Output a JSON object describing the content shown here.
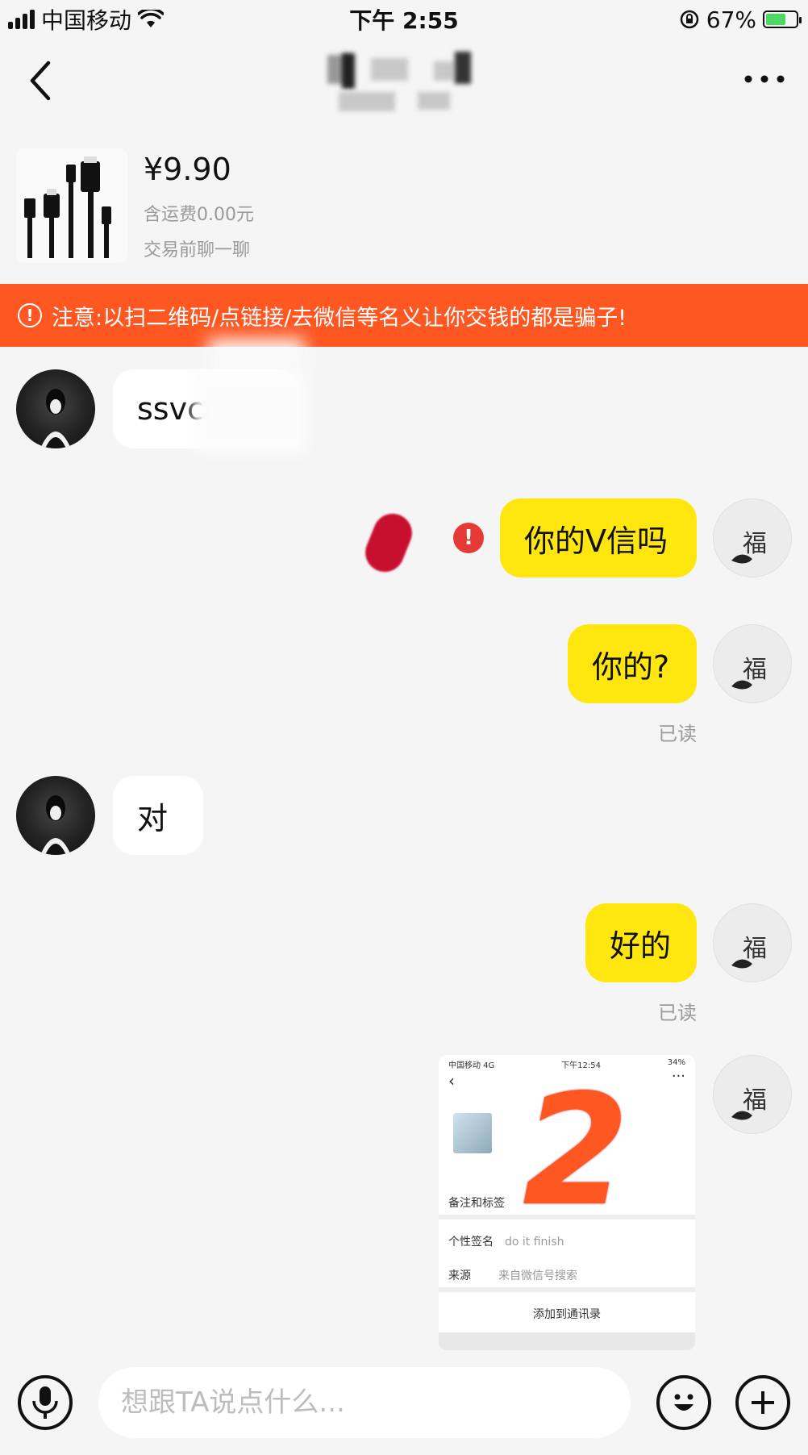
{
  "status_bar": {
    "carrier": "中国移动",
    "time": "下午 2:55",
    "battery": "67%",
    "battery_level": 0.67
  },
  "nav": {
    "back_icon": "chevron-left-icon",
    "more_icon": "more-dots-icon"
  },
  "product": {
    "price": "¥9.90",
    "shipping": "含运费0.00元",
    "hint": "交易前聊一聊"
  },
  "warning": {
    "icon": "!",
    "text": "注意:以扫二维码/点链接/去微信等名义让你交钱的都是骗子!"
  },
  "messages": [
    {
      "from": "other",
      "text": "ssvcn"
    },
    {
      "from": "me",
      "text": "你的V信吗",
      "status": "failed"
    },
    {
      "from": "me",
      "text": "你的?",
      "read": "已读"
    },
    {
      "from": "other",
      "text": "对"
    },
    {
      "from": "me",
      "text": "好的",
      "read": "已读"
    }
  ],
  "screenshot_message": {
    "status_carrier": "中国移动 4G",
    "status_time": "下午12:54",
    "status_right": "34%",
    "row_remark": "备注和标签",
    "row_signature_label": "个性签名",
    "row_signature_value": "do it finish",
    "row_source_label": "来源",
    "row_source_value": "来自微信号搜索",
    "add_button": "添加到通讯录",
    "overlay_number": "2"
  },
  "avatar_me_glyph": "福",
  "input": {
    "placeholder": "想跟TA说点什么...",
    "value": ""
  },
  "colors": {
    "accent": "#ffe60f",
    "warning": "#ff5722",
    "error": "#e53935"
  }
}
